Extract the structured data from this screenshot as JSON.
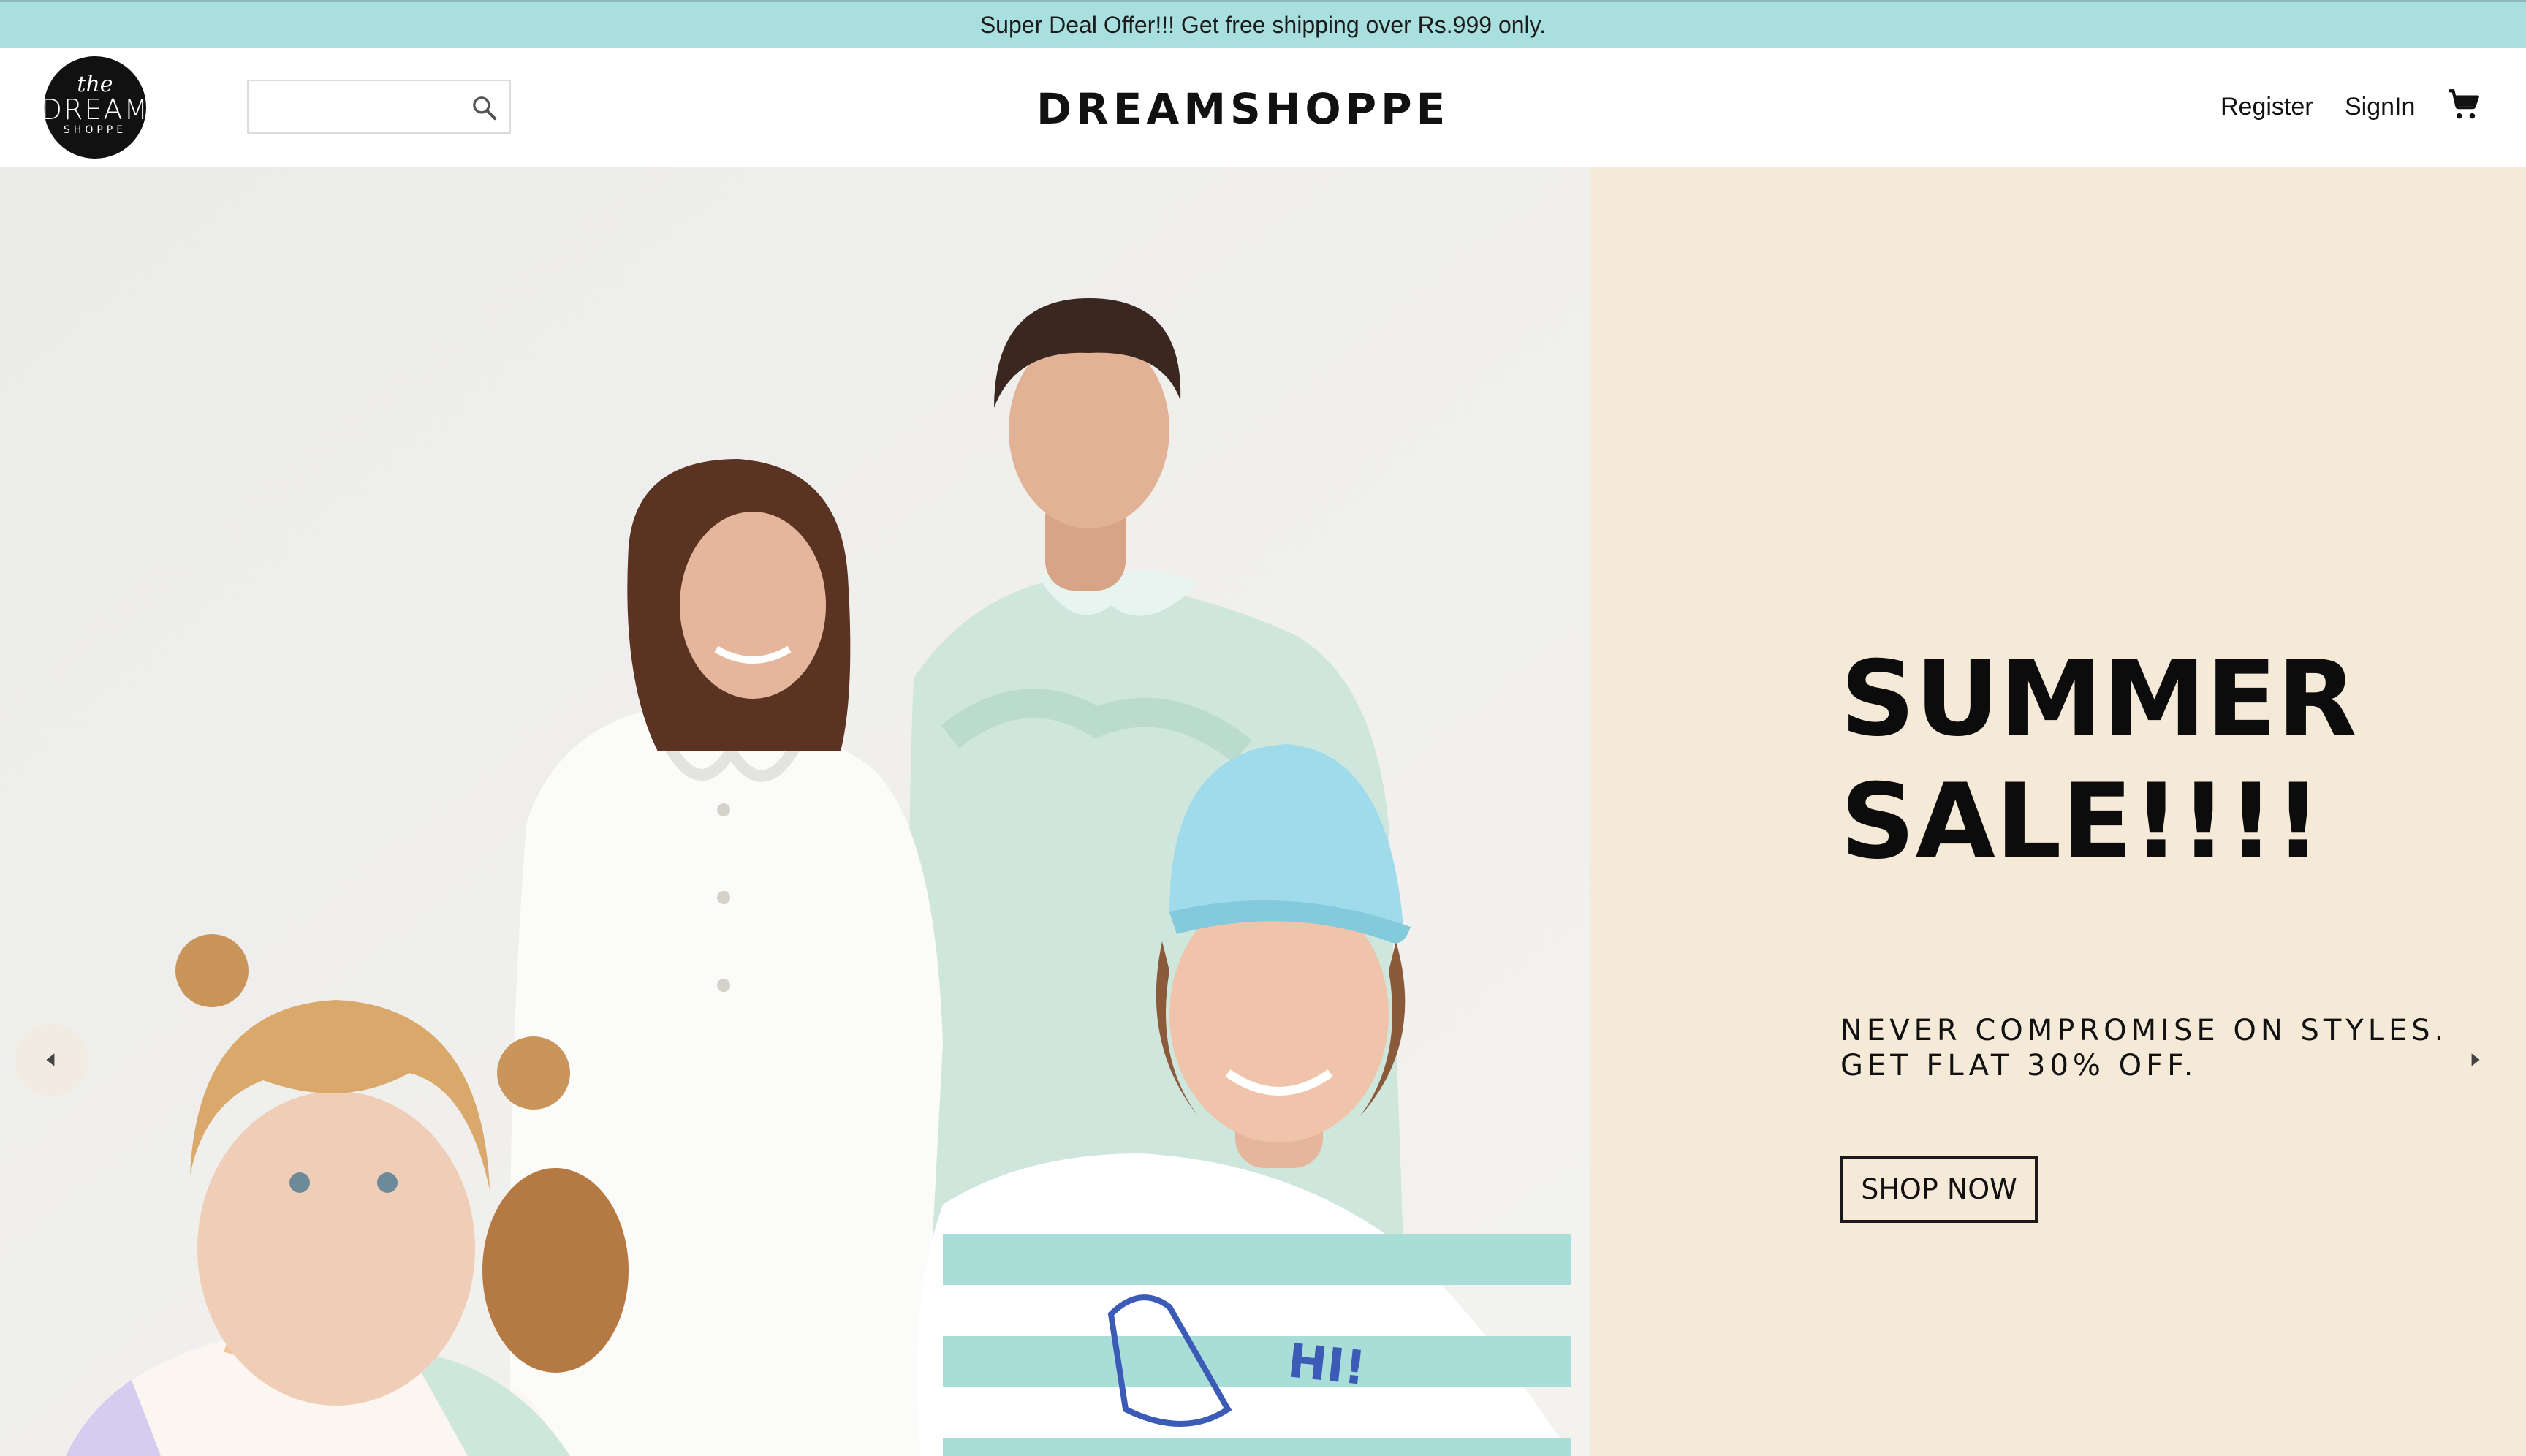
{
  "announcement": {
    "text": "Super Deal Offer!!! Get free shipping over Rs.999 only."
  },
  "header": {
    "logo": {
      "line1": "the",
      "line2": "DREAM",
      "line3": "SHOPPE"
    },
    "search": {
      "value": "",
      "placeholder": ""
    },
    "brand": "DREAMSHOPPE",
    "nav": {
      "register": "Register",
      "signin": "SignIn"
    },
    "icons": {
      "search": "search-icon",
      "cart": "cart-icon"
    }
  },
  "hero": {
    "title_line1": "SUMMER",
    "title_line2": "SALE!!!!",
    "subtitle_line1": "NEVER COMPROMISE ON STYLES.",
    "subtitle_line2": "GET FLAT 30% OFF.",
    "cta": "SHOP NOW",
    "panel_color": "#f5e9d8",
    "icons": {
      "prev": "caret-left-icon",
      "next": "caret-right-icon"
    }
  },
  "colors": {
    "announcement_bg": "#a9dfdf",
    "text": "#111111"
  }
}
